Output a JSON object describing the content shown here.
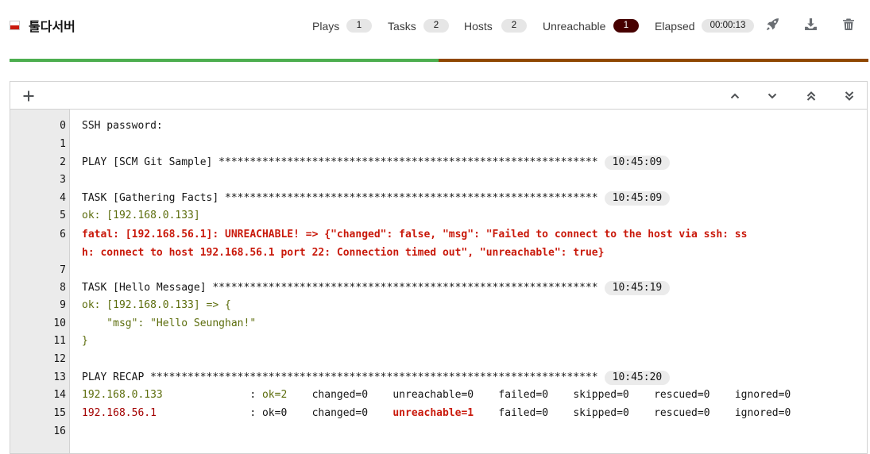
{
  "header": {
    "title": "툴다서버",
    "stats": {
      "plays_label": "Plays",
      "plays_count": "1",
      "tasks_label": "Tasks",
      "tasks_count": "2",
      "hosts_label": "Hosts",
      "hosts_count": "2",
      "unreachable_label": "Unreachable",
      "unreachable_count": "1",
      "elapsed_label": "Elapsed",
      "elapsed_value": "00:00:13"
    },
    "icons": [
      "rocket-icon",
      "download-icon",
      "trash-icon"
    ]
  },
  "progress": {
    "ok_fraction": 0.5,
    "unreachable_fraction": 0.5,
    "ok_color": "#4cae4f",
    "unreachable_color": "#8f4700"
  },
  "toolbar": {
    "icons": [
      "plus-icon",
      "chevron-up-icon",
      "chevron-down-icon",
      "double-chevron-up-icon",
      "double-chevron-down-icon"
    ]
  },
  "output": {
    "l0": "SSH password:",
    "l2": "PLAY [SCM Git Sample] *************************************************************",
    "l2_time": "10:45:09",
    "l4": "TASK [Gathering Facts] ************************************************************",
    "l4_time": "10:45:09",
    "l5": "ok: [192.168.0.133]",
    "l6a": "fatal: [192.168.56.1]: UNREACHABLE! => {\"changed\": false, \"msg\": \"Failed to connect to the host via ssh: ss",
    "l6b": "h: connect to host 192.168.56.1 port 22: Connection timed out\", \"unreachable\": true}",
    "l8": "TASK [Hello Message] **************************************************************",
    "l8_time": "10:45:19",
    "l9": "ok: [192.168.0.133] => {",
    "l10": "    \"msg\": \"Hello Seunghan!\"",
    "l11": "}",
    "l13": "PLAY RECAP ************************************************************************",
    "l13_time": "10:45:20",
    "r1_host": "192.168.0.133",
    "r1_sep": "              : ",
    "r1_ok": "ok=2",
    "r1_rest": "    changed=0    unreachable=0    failed=0    skipped=0    rescued=0    ignored=0",
    "r2_host": "192.168.56.1",
    "r2_sep": "               : ",
    "r2_ok": "ok=0    changed=0    ",
    "r2_unreach": "unreachable=1",
    "r2_rest": "    failed=0    skipped=0    rescued=0    ignored=0"
  },
  "line_numbers": [
    "0",
    "1",
    "2",
    "3",
    "4",
    "5",
    "6",
    "7",
    "8",
    "9",
    "10",
    "11",
    "12",
    "13",
    "14",
    "15",
    "16"
  ]
}
